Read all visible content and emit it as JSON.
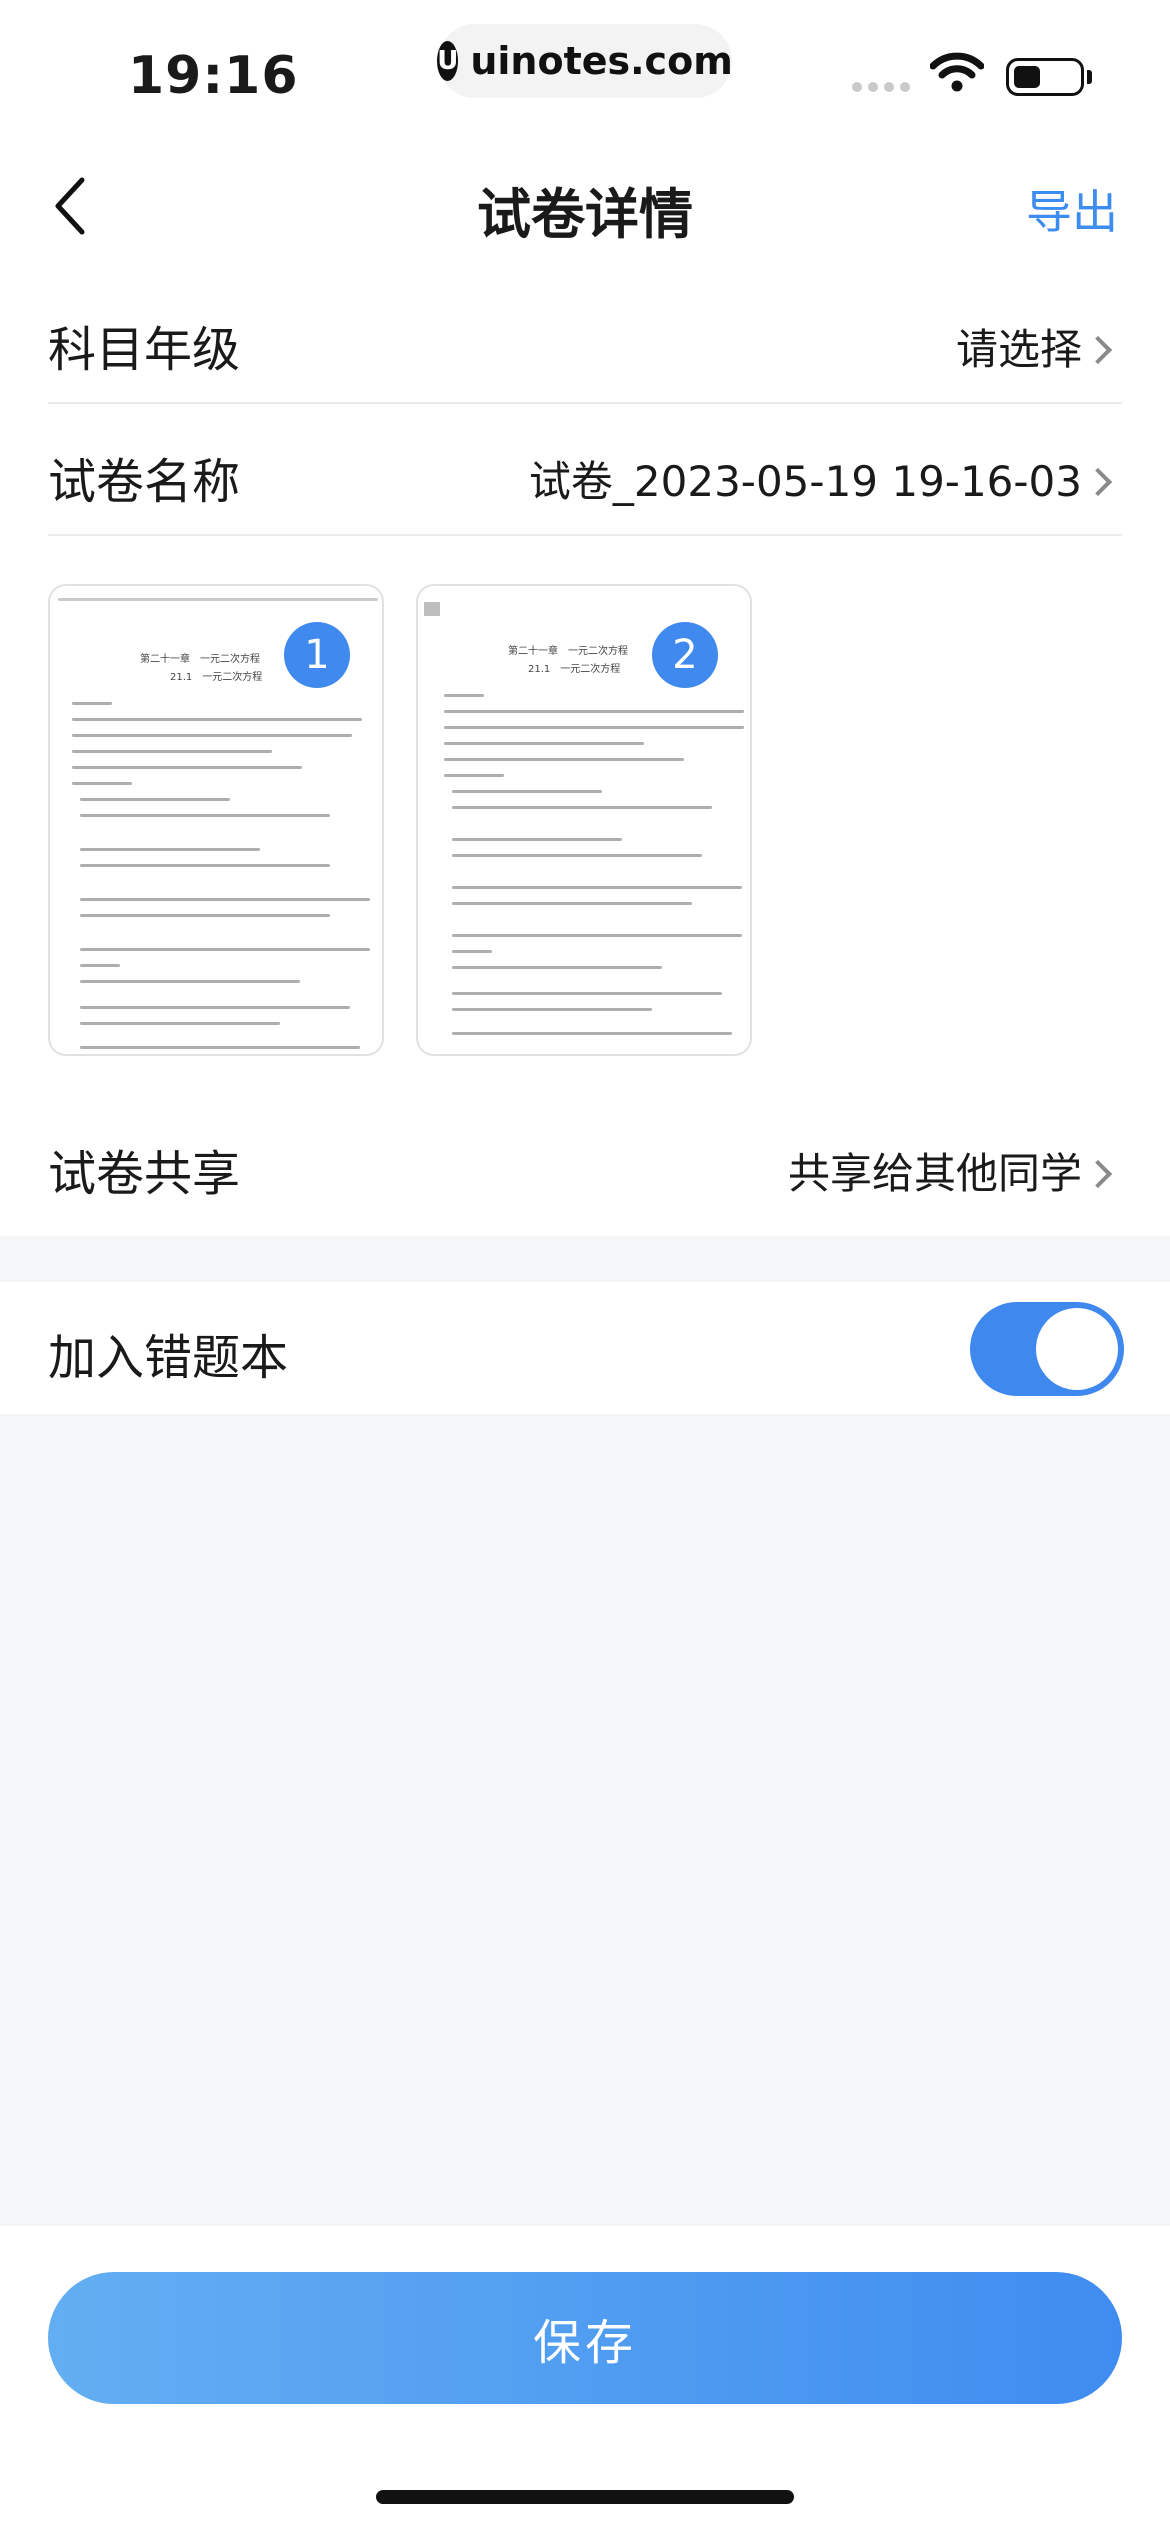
{
  "status_bar": {
    "time": "19:16",
    "url": "uinotes.com",
    "url_logo": "U"
  },
  "nav": {
    "title": "试卷详情",
    "export_label": "导出"
  },
  "rows": {
    "subject": {
      "label": "科目年级",
      "value": "请选择"
    },
    "name": {
      "label": "试卷名称",
      "value": "试卷_2023-05-19 19-16-03"
    },
    "share": {
      "label": "试卷共享",
      "value": "共享给其他同学"
    },
    "wrong_book": {
      "label": "加入错题本",
      "enabled": true
    }
  },
  "thumbnails": [
    {
      "index": "1",
      "header": "第二十一章　一元二次方程",
      "section": "21.1　一元二次方程"
    },
    {
      "index": "2",
      "header": "第二十一章　一元二次方程",
      "section": "21.1　一元二次方程"
    }
  ],
  "save_label": "保存",
  "colors": {
    "accent": "#3d8cf0",
    "toggle_on": "#3e88ee",
    "background_gray": "#f5f6f8"
  }
}
